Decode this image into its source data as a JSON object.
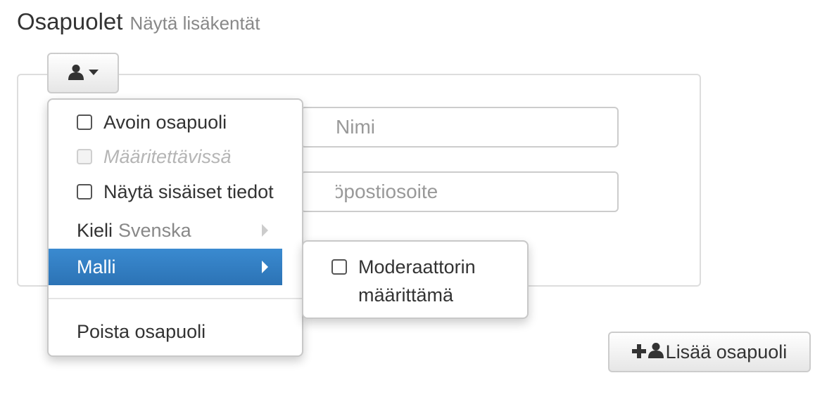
{
  "header": {
    "title": "Osapuolet",
    "show_extra_fields": "Näytä lisäkentät"
  },
  "form": {
    "name_placeholder": "Nimi",
    "email_placeholder": "Sähköpostiosoite"
  },
  "role_menu": {
    "items": [
      {
        "label": "Avoin osapuoli",
        "checked": false,
        "disabled": false
      },
      {
        "label": "Määritettävissä",
        "checked": false,
        "disabled": true
      },
      {
        "label": "Näytä sisäiset tiedot",
        "checked": false,
        "disabled": false
      }
    ],
    "language_label": "Kieli",
    "language_value": "Svenska",
    "template_label": "Malli",
    "remove_label": "Poista osapuoli"
  },
  "template_submenu": {
    "line1": "Moderaattorin",
    "line2": "määrittämä",
    "checked": false
  },
  "add_button": {
    "label": "Lisää osapuoli"
  },
  "icons": {
    "role_toggle": "user-icon",
    "role_caret": "caret-down-icon",
    "submenu_caret": "caret-right-icon",
    "add_plus": "plus-icon",
    "add_user": "user-icon"
  },
  "colors": {
    "active_item": "#2f7ec2",
    "border": "#cccccc",
    "text": "#333333",
    "muted": "#888888"
  }
}
